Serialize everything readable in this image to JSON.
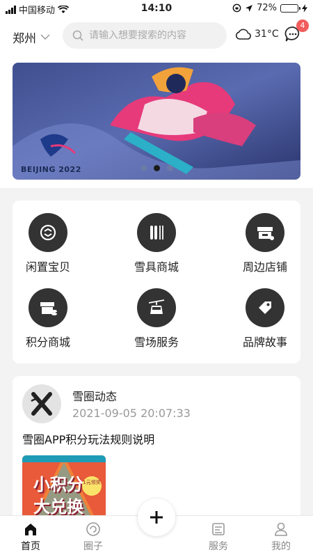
{
  "status": {
    "carrier": "中国移动",
    "time": "14:10",
    "battery": "72%",
    "battery_level": 0.72
  },
  "header": {
    "city": "郑州",
    "search_placeholder": "请输入想要搜索的内容",
    "temperature": "31°C",
    "message_badge": "4"
  },
  "banner": {
    "logo_text": "BEIJING 2022",
    "pages": 3,
    "active_page": 2
  },
  "grid": {
    "items": [
      {
        "label": "闲置宝贝",
        "icon": "recycle-icon"
      },
      {
        "label": "雪具商城",
        "icon": "ski-equipment-icon"
      },
      {
        "label": "周边店铺",
        "icon": "store-icon"
      },
      {
        "label": "积分商城",
        "icon": "points-store-icon"
      },
      {
        "label": "雪场服务",
        "icon": "cable-car-icon"
      },
      {
        "label": "品牌故事",
        "icon": "tag-icon"
      }
    ]
  },
  "post": {
    "author": "雪圈动态",
    "time": "2021-09-05 20:07:33",
    "title": "雪圈APP积分玩法规则说明",
    "image_text_line1": "小积分",
    "image_text_line2": "大兑换",
    "image_badge": "1元领奖"
  },
  "tabs": [
    {
      "label": "首页",
      "icon": "home-icon",
      "active": true
    },
    {
      "label": "圈子",
      "icon": "circle-icon",
      "active": false
    },
    {
      "label": "服务",
      "icon": "service-icon",
      "active": false
    },
    {
      "label": "我的",
      "icon": "user-icon",
      "active": false
    }
  ],
  "colors": {
    "accent": "#333333",
    "badge": "#f25c5c",
    "battery": "#4cd964"
  }
}
